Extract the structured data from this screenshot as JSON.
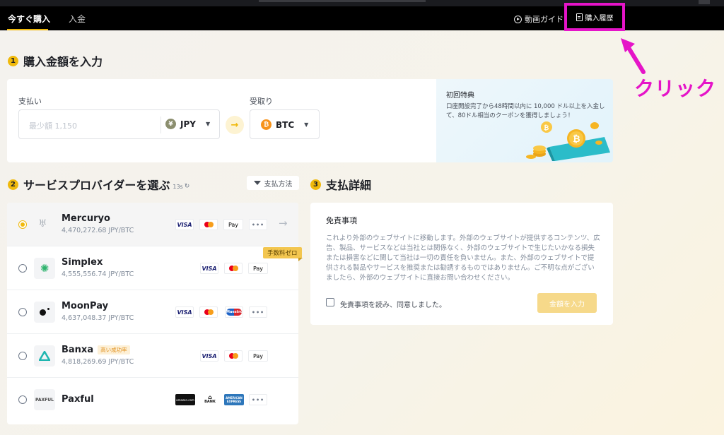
{
  "nav": {
    "tabs": [
      {
        "label": "今すぐ購入"
      },
      {
        "label": "入金"
      }
    ],
    "guide_label": "動画ガイド",
    "history_label": "購入履歴"
  },
  "annotation": {
    "click_label": "クリック"
  },
  "step1": {
    "number": "1",
    "title": "購入金額を入力",
    "pay_label": "支払い",
    "pay_placeholder": "最少額 1,150",
    "pay_currency": "JPY",
    "pay_currency_symbol": "¥",
    "receive_label": "受取り",
    "receive_currency": "BTC",
    "receive_currency_symbol": "₿"
  },
  "promo": {
    "title": "初回特典",
    "text": "口座開設完了から48時間以内に 10,000 ドル以上を入金して、80ドル相当のクーポンを獲得しましょう！"
  },
  "step2": {
    "number": "2",
    "title": "サービスプロバイダーを選ぶ",
    "timer": "13s",
    "filter_label": "支払方法",
    "providers": [
      {
        "name": "Mercuryo",
        "rate": "4,470,272.68 JPY/BTC",
        "selected": true,
        "logo": "mercuryo-logo"
      },
      {
        "name": "Simplex",
        "rate": "4,555,556.74 JPY/BTC",
        "selected": false,
        "badge": "手数料ゼロ",
        "logo": "simplex-logo"
      },
      {
        "name": "MoonPay",
        "rate": "4,637,048.37 JPY/BTC",
        "selected": false,
        "logo": "moonpay-logo"
      },
      {
        "name": "Banxa",
        "rate": "4,818,269.69 JPY/BTC",
        "selected": false,
        "tag": "高い成功率",
        "logo": "banxa-logo"
      },
      {
        "name": "Paxful",
        "rate": "",
        "selected": false,
        "logo_text": "PAXFUL",
        "logo": "paxful-logo"
      }
    ],
    "payment_labels": {
      "visa": "VISA",
      "apple_pay": "Pay",
      "apple_symbol": "",
      "more": "•••",
      "maestro": "Maestro",
      "amazon": "amazon.com",
      "bank": "BANK",
      "amex_line1": "AMERICAN",
      "amex_line2": "EXPRESS"
    }
  },
  "step3": {
    "number": "3",
    "title": "支払詳細",
    "disclaimer_title": "免責事項",
    "disclaimer_text": "これより外部のウェブサイトに移動します。外部のウェブサイトが提供するコンテンツ、広告、製品、サービスなどは当社とは関係なく、外部のウェブサイトで生じたいかなる損失または損害などに関して当社は一切の責任を負いません。また、外部のウェブサイトで提供される製品やサービスを推奨または勧誘するものではありません。ご不明な点がございましたら、外部のウェブサイトに直接お問い合わせください。",
    "agree_label": "免責事項を読み、同意しました。",
    "button_label": "金額を入力"
  },
  "colors": {
    "accent": "#f0b90b",
    "highlight": "#e514c8",
    "nav_bg": "#000000"
  }
}
